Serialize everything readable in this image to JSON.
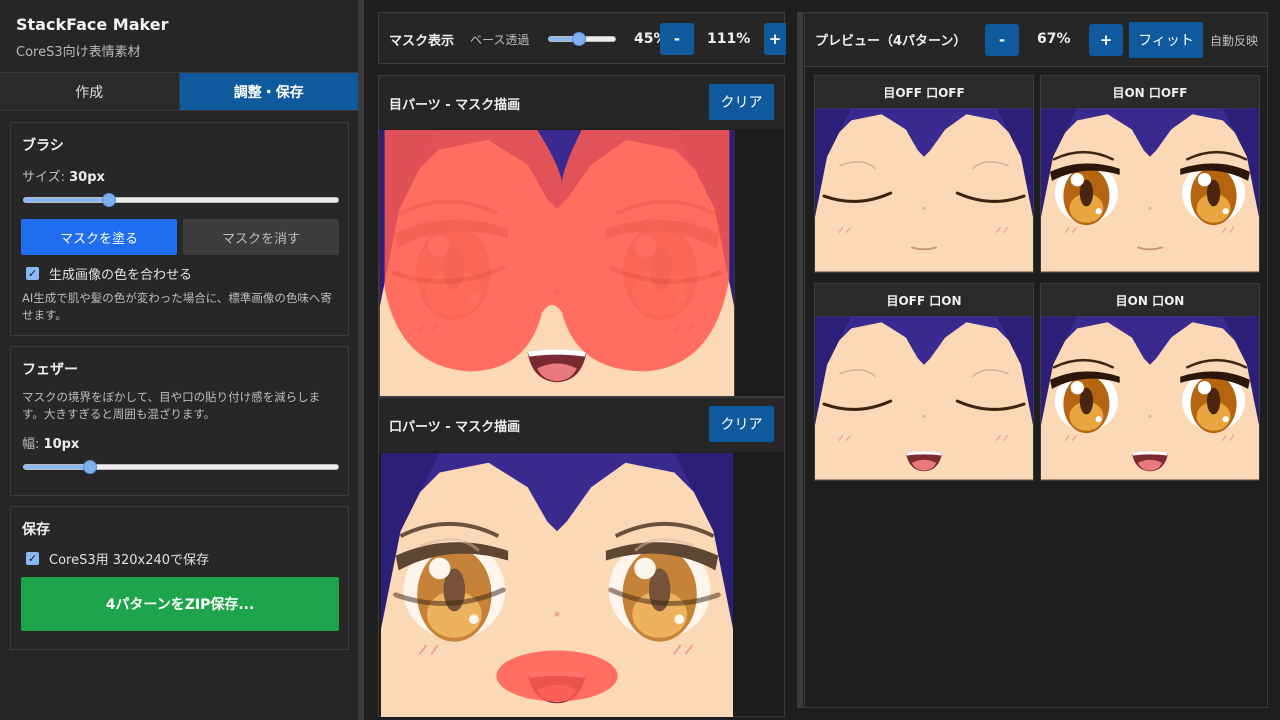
{
  "app": {
    "title": "StackFace Maker",
    "subtitle": "CoreS3向け表情素材"
  },
  "tabs": [
    {
      "label": "作成",
      "active": false
    },
    {
      "label": "調整・保存",
      "active": true
    }
  ],
  "brush": {
    "heading": "ブラシ",
    "size_label": "サイズ:",
    "size_value": "30",
    "size_unit": "px",
    "size_fraction": 0.27,
    "paint_button": "マスクを塗る",
    "erase_button": "マスクを消す",
    "match_color_label": "生成画像の色を合わせる",
    "match_color_checked": true,
    "match_color_note": "AI生成で肌や髪の色が変わった場合に、標準画像の色味へ寄せます。"
  },
  "feather": {
    "heading": "フェザー",
    "note": "マスクの境界をぼかして、目や口の貼り付け感を減らします。大きすぎると周囲も混ざります。",
    "width_label": "幅:",
    "width_value": "10",
    "width_unit": "px",
    "width_fraction": 0.21
  },
  "save": {
    "heading": "保存",
    "cores3_label": "CoreS3用 320x240で保存",
    "cores3_checked": true,
    "zip_button": "4パターンをZIP保存..."
  },
  "mask_view": {
    "title": "マスク表示",
    "opacity_label": "ベース透過",
    "opacity_value": "45%",
    "opacity_fraction": 0.45,
    "minus": "-",
    "plus": "+",
    "zoom": "111%"
  },
  "eye_parts": {
    "title": "目パーツ - マスク描画",
    "clear_button": "クリア"
  },
  "mouth_parts": {
    "title": "口パーツ - マスク描画",
    "clear_button": "クリア"
  },
  "preview": {
    "title": "プレビュー（4パターン）",
    "minus": "-",
    "plus": "+",
    "zoom": "67%",
    "fit_button": "フィット",
    "auto_label": "自動反映",
    "tiles": [
      {
        "label": "目OFF 口OFF"
      },
      {
        "label": "目ON 口OFF"
      },
      {
        "label": "目OFF 口ON"
      },
      {
        "label": "目ON 口ON"
      }
    ]
  },
  "colors": {
    "accent_blue": "#0e5a9c",
    "bright_blue": "#1f6ef0",
    "green": "#1ea44a",
    "mask_red": "#ff5a50",
    "skin": "#fcd9b6",
    "hair": "#3a2a8f"
  }
}
